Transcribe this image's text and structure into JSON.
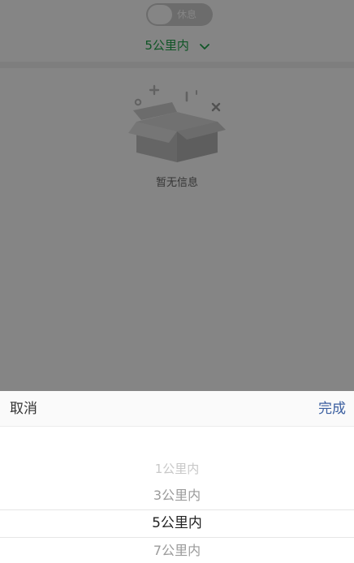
{
  "header": {
    "toggle_label": "休息",
    "distance_label": "5公里内"
  },
  "empty_state": {
    "message": "暂无信息"
  },
  "picker": {
    "cancel_label": "取消",
    "done_label": "完成",
    "options": [
      "1公里内",
      "3公里内",
      "5公里内",
      "7公里内"
    ],
    "selected": "5公里内"
  },
  "colors": {
    "accent_green": "#1fa44a",
    "done_blue": "#3b5fa0"
  },
  "icons": {
    "distance_dropdown": "chevron-down-icon",
    "empty": "empty-box-icon"
  }
}
